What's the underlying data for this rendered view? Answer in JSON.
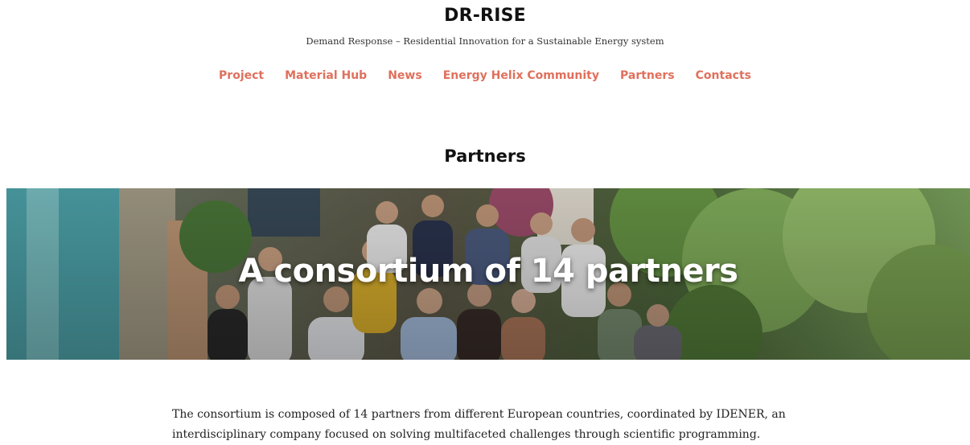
{
  "site": {
    "title": "DR-RISE",
    "tagline": "Demand Response – Residential Innovation for a Sustainable Energy system"
  },
  "nav": {
    "items": [
      {
        "label": "Project"
      },
      {
        "label": "Material Hub"
      },
      {
        "label": "News"
      },
      {
        "label": "Energy Helix Community"
      },
      {
        "label": "Partners"
      },
      {
        "label": "Contacts"
      }
    ]
  },
  "page": {
    "title": "Partners",
    "hero_heading": "A consortium of 14 partners",
    "intro": "The consortium is composed of 14 partners from different European countries, coordinated by IDENER, an interdisciplinary company focused on solving multifaceted challenges through scientific programming."
  },
  "colors": {
    "accent": "#e0705c",
    "text": "#111111"
  }
}
